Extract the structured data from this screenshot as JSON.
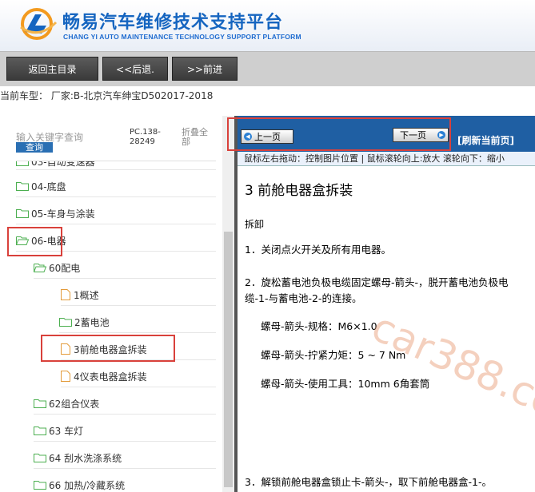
{
  "header": {
    "title_cn": "畅易汽车维修技术支持平台",
    "title_en": "CHANG YI AUTO MAINTENANCE TECHNOLOGY SUPPORT PLATFORM"
  },
  "toolbar": {
    "home_label": "返回主目录",
    "back_label": "<<后退.",
    "forward_label": ">>前进"
  },
  "car_info": "当前车型：  厂家:B-北京汽车绅宝D502017-2018",
  "sidebar": {
    "search_placeholder": "输入关键字查询",
    "query_label": "查询",
    "code": "PC.138-28249",
    "collapse_label": "折叠全部",
    "items": [
      {
        "label": "03-自动变速器"
      },
      {
        "label": "04-底盘"
      },
      {
        "label": "05-车身与涂装"
      },
      {
        "label": "06-电器"
      },
      {
        "label": "60配电"
      },
      {
        "label": "1概述"
      },
      {
        "label": "2蓄电池"
      },
      {
        "label": "3前舱电器盒拆装"
      },
      {
        "label": "4仪表电器盒拆装"
      },
      {
        "label": "62组合仪表"
      },
      {
        "label": "63 车灯"
      },
      {
        "label": "64 刮水洗涤系统"
      },
      {
        "label": "66 加热/冷藏系统"
      }
    ]
  },
  "nav": {
    "prev_label": "上一页",
    "next_label": "下一页",
    "refresh_label": "[刷新当前页]",
    "tip": "鼠标左右拖动：控制图片位置 | 鼠标滚轮向上:放大  滚轮向下：缩小"
  },
  "content": {
    "title": "3 前舱电器盒拆装",
    "section": "拆卸",
    "step1": "1．关闭点火开关及所有用电器。",
    "step2": "2．旋松蓄电池负极电缆固定螺母-箭头-，脱开蓄电池负极电缆-1-与蓄电池-2-的连接。",
    "spec1": "螺母-箭头-规格：M6×1.0",
    "spec2": "螺母-箭头-拧紧力矩：5 ~ 7 Nm",
    "spec3": "螺母-箭头-使用工具：10mm 6角套筒",
    "step3": "3．解锁前舱电器盒锁止卡-箭头-，取下前舱电器盒-1-。"
  },
  "watermark": "car388.com",
  "colors": {
    "brand": "#1565c0",
    "nav_bar": "#1f5fa3",
    "highlight": "#d9413b"
  }
}
